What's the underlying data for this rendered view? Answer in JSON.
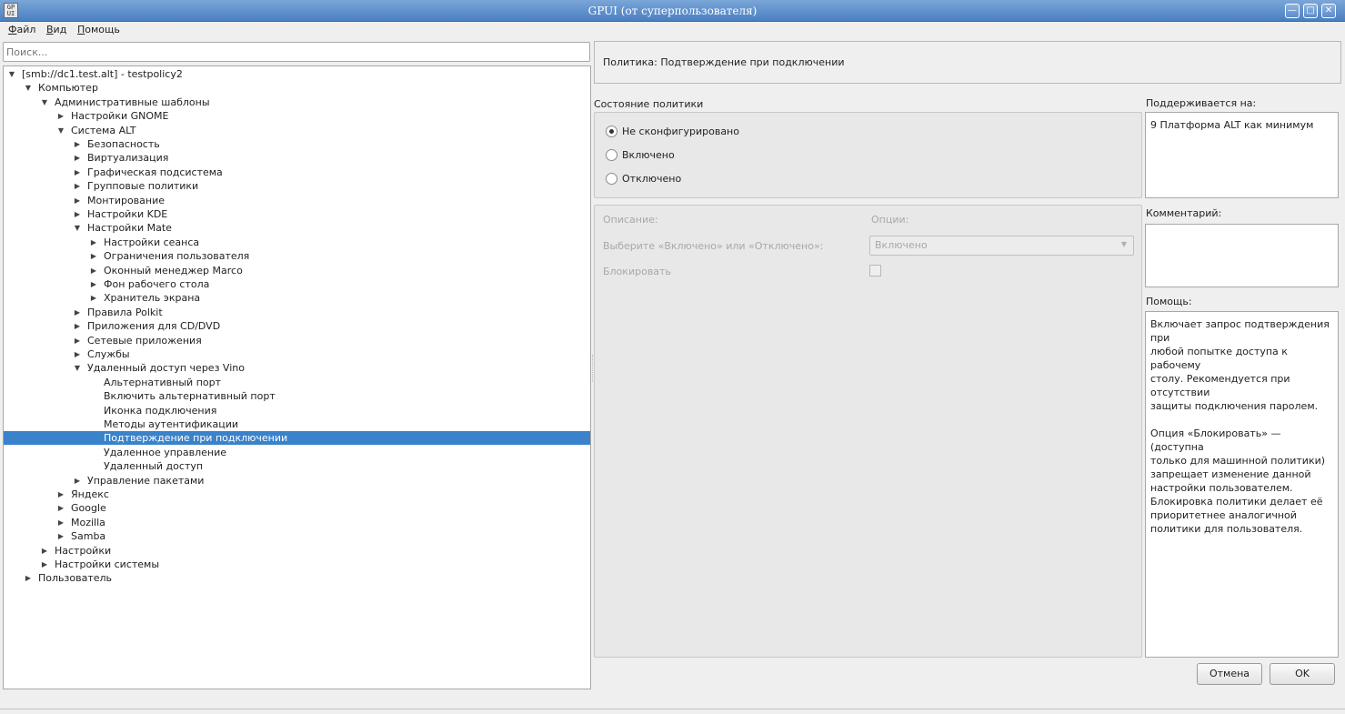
{
  "window": {
    "title": "GPUI (от суперпользователя)",
    "icon_text": "GP\nUI",
    "controls": {
      "minimize": "—",
      "maximize": "□",
      "close": "✕"
    }
  },
  "menu": [
    "Файл",
    "Вид",
    "Помощь"
  ],
  "search": {
    "placeholder": "Поиск..."
  },
  "tree": [
    {
      "label": "[smb://dc1.test.alt] - testpolicy2",
      "level": 0,
      "state": "open"
    },
    {
      "label": "Компьютер",
      "level": 1,
      "state": "open"
    },
    {
      "label": "Административные шаблоны",
      "level": 2,
      "state": "open"
    },
    {
      "label": "Настройки GNOME",
      "level": 3,
      "state": "closed"
    },
    {
      "label": "Система ALT",
      "level": 3,
      "state": "open"
    },
    {
      "label": "Безопасность",
      "level": 4,
      "state": "closed"
    },
    {
      "label": "Виртуализация",
      "level": 4,
      "state": "closed"
    },
    {
      "label": "Графическая подсистема",
      "level": 4,
      "state": "closed"
    },
    {
      "label": "Групповые политики",
      "level": 4,
      "state": "closed"
    },
    {
      "label": "Монтирование",
      "level": 4,
      "state": "closed"
    },
    {
      "label": "Настройки KDE",
      "level": 4,
      "state": "closed"
    },
    {
      "label": "Настройки Mate",
      "level": 4,
      "state": "open"
    },
    {
      "label": "Настройки сеанса",
      "level": 5,
      "state": "closed"
    },
    {
      "label": "Ограничения пользователя",
      "level": 5,
      "state": "closed"
    },
    {
      "label": "Оконный менеджер Marco",
      "level": 5,
      "state": "closed"
    },
    {
      "label": "Фон рабочего стола",
      "level": 5,
      "state": "closed"
    },
    {
      "label": "Хранитель экрана",
      "level": 5,
      "state": "closed"
    },
    {
      "label": "Правила Polkit",
      "level": 4,
      "state": "closed"
    },
    {
      "label": "Приложения для CD/DVD",
      "level": 4,
      "state": "closed"
    },
    {
      "label": "Сетевые приложения",
      "level": 4,
      "state": "closed"
    },
    {
      "label": "Службы",
      "level": 4,
      "state": "closed"
    },
    {
      "label": "Удаленный доступ через Vino",
      "level": 4,
      "state": "open"
    },
    {
      "label": "Альтернативный порт",
      "level": 5,
      "state": "leaf"
    },
    {
      "label": "Включить альтернативный порт",
      "level": 5,
      "state": "leaf"
    },
    {
      "label": "Иконка подключения",
      "level": 5,
      "state": "leaf"
    },
    {
      "label": "Методы аутентификации",
      "level": 5,
      "state": "leaf"
    },
    {
      "label": "Подтверждение при подключении",
      "level": 5,
      "state": "leaf",
      "selected": true
    },
    {
      "label": "Удаленное управление",
      "level": 5,
      "state": "leaf"
    },
    {
      "label": "Удаленный доступ",
      "level": 5,
      "state": "leaf"
    },
    {
      "label": "Управление пакетами",
      "level": 4,
      "state": "closed"
    },
    {
      "label": "Яндекс",
      "level": 3,
      "state": "closed"
    },
    {
      "label": "Google",
      "level": 3,
      "state": "closed"
    },
    {
      "label": "Mozilla",
      "level": 3,
      "state": "closed"
    },
    {
      "label": "Samba",
      "level": 3,
      "state": "closed"
    },
    {
      "label": "Настройки",
      "level": 2,
      "state": "closed"
    },
    {
      "label": "Настройки системы",
      "level": 2,
      "state": "closed"
    },
    {
      "label": "Пользователь",
      "level": 1,
      "state": "closed"
    }
  ],
  "policy": {
    "header": "Политика: Подтверждение при подключении",
    "state_label": "Состояние политики",
    "states": [
      {
        "label": "Не сконфигурировано",
        "checked": true
      },
      {
        "label": "Включено",
        "checked": false
      },
      {
        "label": "Отключено",
        "checked": false
      }
    ],
    "description_label": "Описание:",
    "options_label": "Опции:",
    "choose_label": "Выберите «Включено» или «Отключено»:",
    "choose_value": "Включено",
    "lock_label": "Блокировать",
    "lock_checked": false
  },
  "supported": {
    "label": "Поддерживается на:",
    "value": "9 Платформа ALT как минимум"
  },
  "comment": {
    "label": "Комментарий:",
    "value": ""
  },
  "help": {
    "label": "Помощь:",
    "paragraphs": [
      "Включает запрос подтверждения при\nлюбой попытке доступа к рабочему\nстолу. Рекомендуется при отсутствии\nзащиты подключения паролем.",
      "Опция «Блокировать» — (доступна\nтолько для машинной политики)\nзапрещает изменение данной\nнастройки пользователем.\nБлокировка политики делает её\nприоритетнее аналогичной\nполитики для пользователя."
    ]
  },
  "buttons": {
    "cancel": "Отмена",
    "ok": "OK"
  },
  "colors": {
    "selection": "#3a83cb",
    "titlebar": "#5b8cc8"
  }
}
